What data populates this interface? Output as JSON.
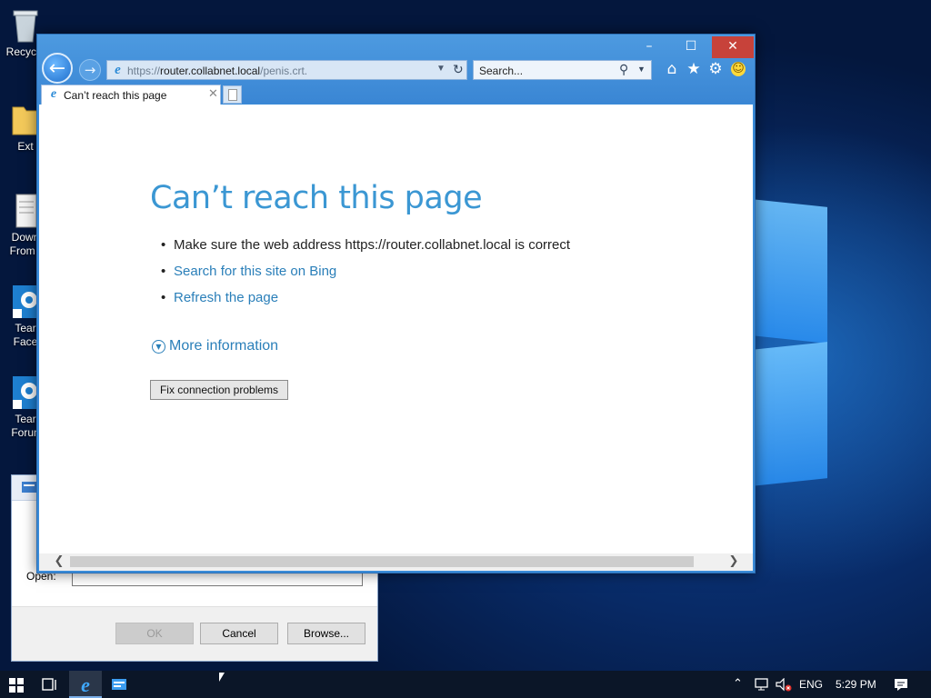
{
  "desktop": {
    "icons": [
      {
        "label": "Recycle"
      },
      {
        "label": "Ext"
      },
      {
        "label": "Down",
        "label2": "From t"
      },
      {
        "label": "Tear",
        "label2": "Face"
      },
      {
        "label": "Tear",
        "label2": "Forun"
      }
    ]
  },
  "run_dialog": {
    "open_label": "Open:",
    "buttons": {
      "ok": "OK",
      "cancel": "Cancel",
      "browse": "Browse..."
    }
  },
  "ie": {
    "caption": {
      "minimize": "–",
      "maximize": "☐",
      "close": "✕"
    },
    "address": {
      "prefix": "https://",
      "host": "router.collabnet.local",
      "path": "/penis.crt."
    },
    "search_placeholder": "Search...",
    "tab_label": "Can’t reach this page",
    "page": {
      "title": "Can’t reach this page",
      "bullets": [
        "Make sure the web address https://router.collabnet.local is correct",
        "Search for this site on Bing",
        "Refresh the page"
      ],
      "more_info": "More information",
      "fix_button": "Fix connection problems"
    }
  },
  "taskbar": {
    "language": "ENG",
    "time": "5:29 PM"
  },
  "colors": {
    "accent": "#3b97d3",
    "link": "#2a7fb9",
    "frame": "#3a8bd8",
    "close": "#c7423a"
  }
}
